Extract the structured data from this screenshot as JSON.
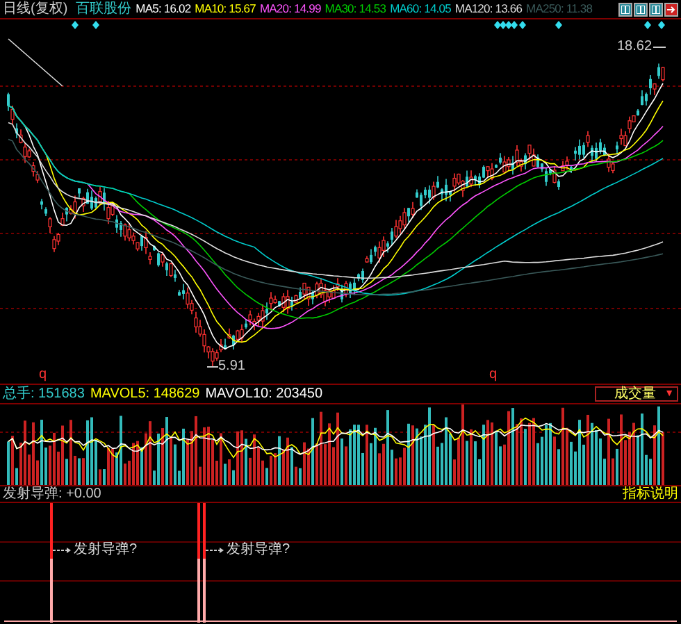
{
  "header": {
    "period": "日线(复权)",
    "stock": "百联股份",
    "ma": [
      {
        "label": "MA5: 16.02",
        "color": "#ffffff"
      },
      {
        "label": "MA10: 15.67",
        "color": "#ffff00"
      },
      {
        "label": "MA20: 14.99",
        "color": "#ff55ff"
      },
      {
        "label": "MA30: 14.53",
        "color": "#00cc00"
      },
      {
        "label": "MA60: 14.05",
        "color": "#00cccc"
      },
      {
        "label": "MA120: 13.66",
        "color": "#dddddd"
      },
      {
        "label": "MA250: 11.38",
        "color": "#3a5a5a"
      }
    ]
  },
  "price_chart": {
    "high_label": "18.62",
    "low_label": "5.91",
    "markers": [
      "q",
      "q"
    ]
  },
  "volume": {
    "stats": [
      {
        "label": "总手: 151683",
        "color": "#33cccc"
      },
      {
        "label": "MAVOL5: 148629",
        "color": "#ffff00"
      },
      {
        "label": "MAVOL10: 203450",
        "color": "#ffffff"
      }
    ],
    "selector": "成交量",
    "selector_arrow": "▼"
  },
  "indicator": {
    "title": "发射导弹: +0.00",
    "help": "指标说明",
    "signals": [
      "发射导弹?",
      "发射导弹?"
    ]
  }
}
